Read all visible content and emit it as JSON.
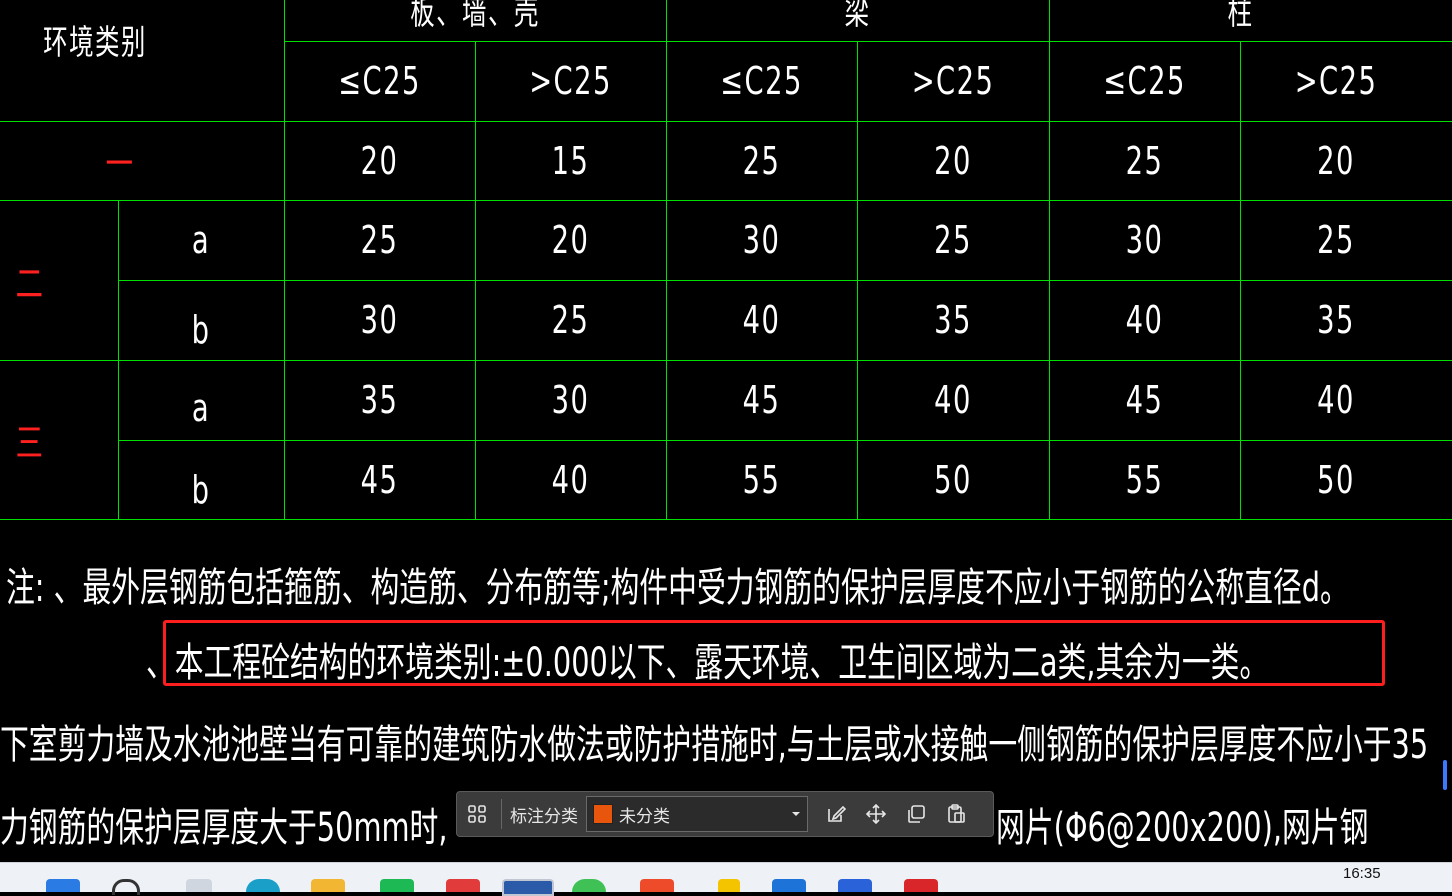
{
  "table": {
    "corner_label": "环境类别",
    "groups": [
      "板、墙、壳",
      "梁",
      "柱"
    ],
    "grades": [
      "≤C25",
      ">C25",
      "≤C25",
      ">C25",
      "≤C25",
      ">C25"
    ],
    "rows": [
      {
        "category": "一",
        "sub": "",
        "values": [
          "20",
          "15",
          "25",
          "20",
          "25",
          "20"
        ]
      },
      {
        "category": "二",
        "sub": "a",
        "values": [
          "25",
          "20",
          "30",
          "25",
          "30",
          "25"
        ]
      },
      {
        "category": "",
        "sub": "b",
        "values": [
          "30",
          "25",
          "40",
          "35",
          "40",
          "35"
        ]
      },
      {
        "category": "三",
        "sub": "a",
        "values": [
          "35",
          "30",
          "45",
          "40",
          "45",
          "40"
        ]
      },
      {
        "category": "",
        "sub": "b",
        "values": [
          "45",
          "40",
          "55",
          "50",
          "55",
          "50"
        ]
      }
    ]
  },
  "notes": {
    "line1": "注:      、最外层钢筋包括箍筋、构造筋、分布筋等;构件中受力钢筋的保护层厚度不应小于钢筋的公称直径d。",
    "line2": "、本工程砼结构的环境类别:±0.000以下、露天环境、卫生间区域为二a类,其余为一类。",
    "line3": "下室剪力墙及水池池壁当有可靠的建筑防水做法或防护措施时,与土层或水接触一侧钢筋的保护层厚度不应小于35",
    "line4_left": "力钢筋的保护层厚度大于50mm时,",
    "line4_right": "网片(Φ6@200x200),网片钢"
  },
  "toolbar": {
    "label": "标注分类",
    "selected": "未分类",
    "swatch_color": "#e8560e"
  },
  "taskbar": {
    "time": "16:35"
  },
  "colors": {
    "grid": "#00e000",
    "highlight": "#ff1e1e"
  }
}
